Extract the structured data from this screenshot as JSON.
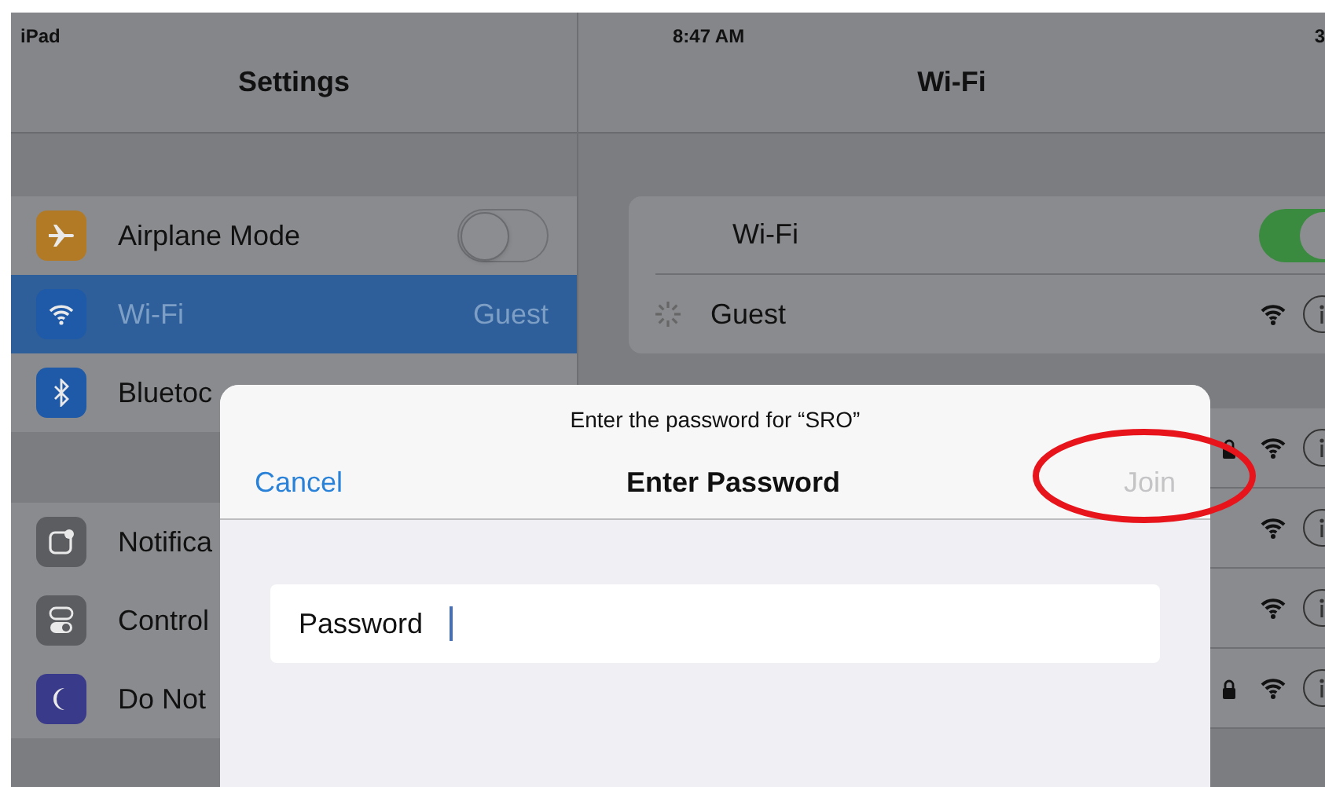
{
  "status_bar": {
    "device": "iPad",
    "time": "8:47 AM",
    "battery": "3"
  },
  "sidebar": {
    "title": "Settings",
    "groups": [
      [
        {
          "label": "Airplane Mode",
          "kind": "toggle",
          "on": false,
          "selected": false
        },
        {
          "label": "Wi-Fi",
          "kind": "value",
          "value": "Guest",
          "selected": true
        },
        {
          "label": "Bluetoc",
          "kind": "plain",
          "selected": false
        }
      ],
      [
        {
          "label": "Notifica",
          "kind": "plain",
          "selected": false
        },
        {
          "label": "Control",
          "kind": "plain",
          "selected": false
        },
        {
          "label": "Do Not",
          "kind": "plain",
          "selected": false
        }
      ]
    ]
  },
  "detail": {
    "title": "Wi-Fi",
    "wifi_row": {
      "label": "Wi-Fi",
      "on": true
    },
    "current_network": {
      "name": "Guest",
      "connecting": true
    },
    "networks": [
      {
        "locked": true
      },
      {
        "locked": false
      },
      {
        "locked": false
      },
      {
        "locked": true
      }
    ]
  },
  "dialog": {
    "prompt": "Enter the password for “SRO”",
    "title": "Enter Password",
    "cancel": "Cancel",
    "join": {
      "label": "Join",
      "disabled": true,
      "circled": true
    },
    "field_label": "Password"
  }
}
